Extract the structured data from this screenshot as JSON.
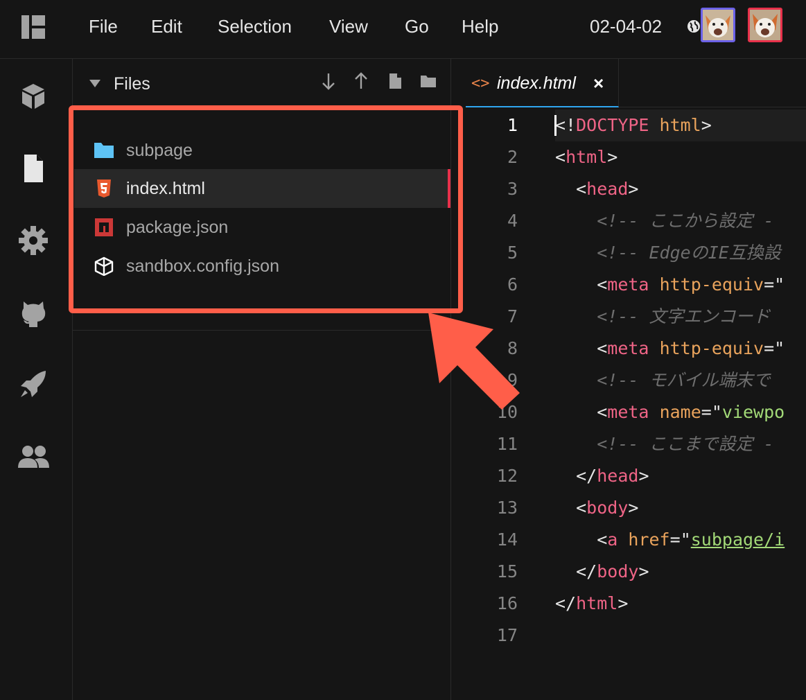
{
  "menu": {
    "items": [
      "File",
      "Edit",
      "Selection",
      "View",
      "Go",
      "Help"
    ]
  },
  "project": {
    "name": "02-04-02"
  },
  "explorer": {
    "title": "Files",
    "files": [
      {
        "name": "subpage",
        "icon": "folder-icon"
      },
      {
        "name": "index.html",
        "icon": "html5-icon",
        "active": true
      },
      {
        "name": "package.json",
        "icon": "npm-icon"
      },
      {
        "name": "sandbox.config.json",
        "icon": "codesandbox-icon"
      }
    ]
  },
  "editor": {
    "tab": {
      "icon_text": "<>",
      "label": "index.html",
      "close": "×"
    },
    "current_line": 1,
    "lines": [
      {
        "n": "1",
        "text": "<!DOCTYPE html>"
      },
      {
        "n": "2",
        "text": "<html>"
      },
      {
        "n": "3",
        "text": "  <head>"
      },
      {
        "n": "4",
        "text": "    <!-- ここから設定 -"
      },
      {
        "n": "5",
        "text": "    <!-- EdgeのIE互換設"
      },
      {
        "n": "6",
        "text": "    <meta http-equiv=\""
      },
      {
        "n": "7",
        "text": "    <!-- 文字エンコード"
      },
      {
        "n": "8",
        "text": "    <meta http-equiv=\""
      },
      {
        "n": "9",
        "text": "    <!-- モバイル端末で"
      },
      {
        "n": "10",
        "text": "    <meta name=\"viewpo"
      },
      {
        "n": "11",
        "text": "    <!-- ここまで設定 -"
      },
      {
        "n": "12",
        "text": "  </head>"
      },
      {
        "n": "13",
        "text": "  <body>"
      },
      {
        "n": "14",
        "text": "    <a href=\"subpage/i"
      },
      {
        "n": "15",
        "text": "  </body>"
      },
      {
        "n": "16",
        "text": "</html>"
      },
      {
        "n": "17",
        "text": ""
      }
    ]
  },
  "colors": {
    "background": "#151515",
    "accent_red": "#e8314b",
    "accent_blue": "#2fa6f0",
    "annotation": "#ff5e49"
  }
}
